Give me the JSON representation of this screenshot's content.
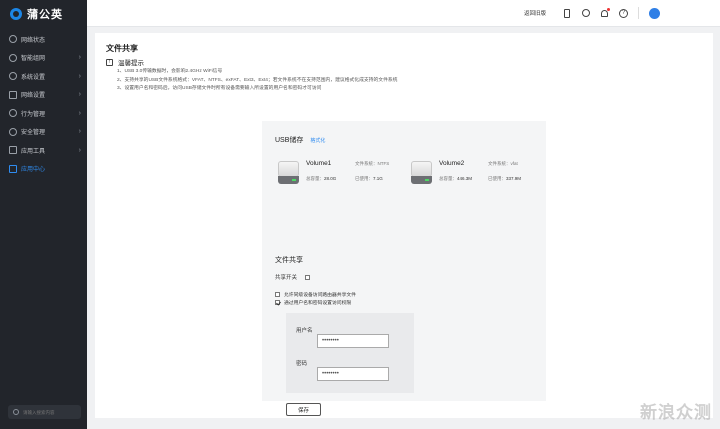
{
  "brand": {
    "name": "蒲公英"
  },
  "sidebar": {
    "items": [
      {
        "label": "网络状态",
        "arrow": ""
      },
      {
        "label": "智能组网",
        "arrow": "›"
      },
      {
        "label": "系统设置",
        "arrow": "›"
      },
      {
        "label": "网络设置",
        "arrow": "›"
      },
      {
        "label": "行为管理",
        "arrow": "›"
      },
      {
        "label": "安全管理",
        "arrow": "›"
      },
      {
        "label": "应用工具",
        "arrow": "›"
      },
      {
        "label": "应用中心",
        "arrow": ""
      }
    ],
    "search_placeholder": "请输入搜索内容"
  },
  "topbar": {
    "link": "返回旧版",
    "help": "?"
  },
  "page": {
    "title": "文件共享",
    "tip_title": "温馨提示",
    "tips": [
      "1、USB 3.0传输数据时，会影响2.4GHz WiFi信号",
      "2、支持共享的USB文件系统格式：VFAT、NTFS、exFAT、Ext3、Ext4；若文件系统不在支持范围内，建议格式化成支持的文件系统",
      "3、设置用户名和密码后，访问USB存储文件时所有设备需要输入所设置的用户名和密码才可访问"
    ]
  },
  "usb": {
    "title": "USB储存",
    "format_link": "格式化",
    "volumes": [
      {
        "name": "Volume1",
        "fs_label": "文件系统：",
        "fs": "NTFS",
        "total_label": "总容量：",
        "total": "28.0G",
        "used_label": "已使用：",
        "used": "7.1G"
      },
      {
        "name": "Volume2",
        "fs_label": "文件系统：",
        "fs": "vfat",
        "total_label": "总容量：",
        "total": "446.3M",
        "used_label": "已使用：",
        "used": "337.9M"
      }
    ]
  },
  "share": {
    "title": "文件共享",
    "switch_label": "共享开关",
    "option_anonymous": "允许同级设备访问路由器共享文件",
    "option_auth": "通过用户名和密码设置访问权限",
    "username_label": "用户名",
    "password_label": "密码",
    "username_value": "••••••••",
    "password_value": "••••••••",
    "save_label": "保存"
  },
  "watermark": "新浪众测"
}
